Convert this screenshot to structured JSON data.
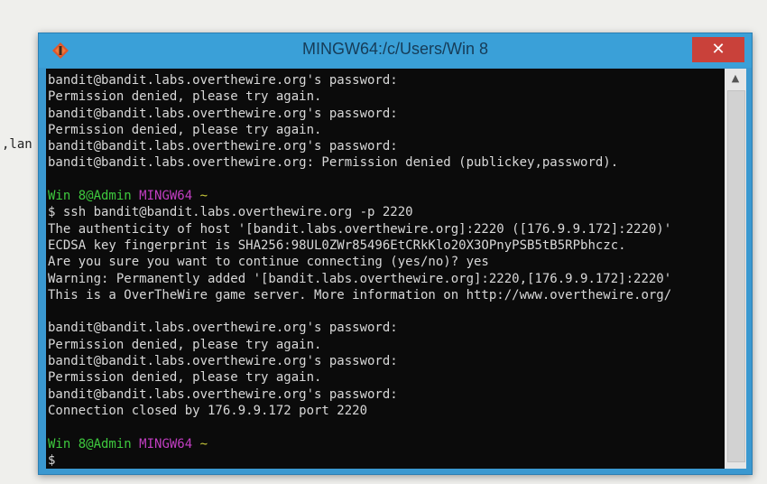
{
  "background": {
    "fragment_text": ",lan"
  },
  "window": {
    "title": "MINGW64:/c/Users/Win 8",
    "close_glyph": "✕",
    "scroll_up_glyph": "▲"
  },
  "terminal": {
    "lines": [
      [
        {
          "t": "bandit@bandit.labs.overthewire.org's password:",
          "c": ""
        }
      ],
      [
        {
          "t": "Permission denied, please try again.",
          "c": ""
        }
      ],
      [
        {
          "t": "bandit@bandit.labs.overthewire.org's password:",
          "c": ""
        }
      ],
      [
        {
          "t": "Permission denied, please try again.",
          "c": ""
        }
      ],
      [
        {
          "t": "bandit@bandit.labs.overthewire.org's password:",
          "c": ""
        }
      ],
      [
        {
          "t": "bandit@bandit.labs.overthewire.org: Permission denied (publickey,password).",
          "c": ""
        }
      ],
      [
        {
          "t": "",
          "c": ""
        }
      ],
      [
        {
          "t": "Win 8@Admin ",
          "c": "green"
        },
        {
          "t": "MINGW64 ",
          "c": "magenta"
        },
        {
          "t": "~",
          "c": "yellow"
        }
      ],
      [
        {
          "t": "$ ssh bandit@bandit.labs.overthewire.org -p 2220",
          "c": ""
        }
      ],
      [
        {
          "t": "The authenticity of host '[bandit.labs.overthewire.org]:2220 ([176.9.9.172]:2220)'",
          "c": ""
        }
      ],
      [
        {
          "t": "ECDSA key fingerprint is SHA256:98UL0ZWr85496EtCRkKlo20X3OPnyPSB5tB5RPbhczc.",
          "c": ""
        }
      ],
      [
        {
          "t": "Are you sure you want to continue connecting (yes/no)? yes",
          "c": ""
        }
      ],
      [
        {
          "t": "Warning: Permanently added '[bandit.labs.overthewire.org]:2220,[176.9.9.172]:2220'",
          "c": ""
        }
      ],
      [
        {
          "t": "This is a OverTheWire game server. More information on http://www.overthewire.org/",
          "c": ""
        }
      ],
      [
        {
          "t": "",
          "c": ""
        }
      ],
      [
        {
          "t": "bandit@bandit.labs.overthewire.org's password:",
          "c": ""
        }
      ],
      [
        {
          "t": "Permission denied, please try again.",
          "c": ""
        }
      ],
      [
        {
          "t": "bandit@bandit.labs.overthewire.org's password:",
          "c": ""
        }
      ],
      [
        {
          "t": "Permission denied, please try again.",
          "c": ""
        }
      ],
      [
        {
          "t": "bandit@bandit.labs.overthewire.org's password:",
          "c": ""
        }
      ],
      [
        {
          "t": "Connection closed by 176.9.9.172 port 2220",
          "c": ""
        }
      ],
      [
        {
          "t": "",
          "c": ""
        }
      ],
      [
        {
          "t": "Win 8@Admin ",
          "c": "green"
        },
        {
          "t": "MINGW64 ",
          "c": "magenta"
        },
        {
          "t": "~",
          "c": "yellow"
        }
      ],
      [
        {
          "t": "$",
          "c": ""
        }
      ]
    ]
  },
  "colors": {
    "titlebar": "#3aa0d8",
    "close_button": "#c9413a",
    "terminal_bg": "#0b0b0b",
    "prompt_user": "#3ec93e",
    "prompt_host": "#c23ec2",
    "prompt_path": "#c9c93a"
  }
}
